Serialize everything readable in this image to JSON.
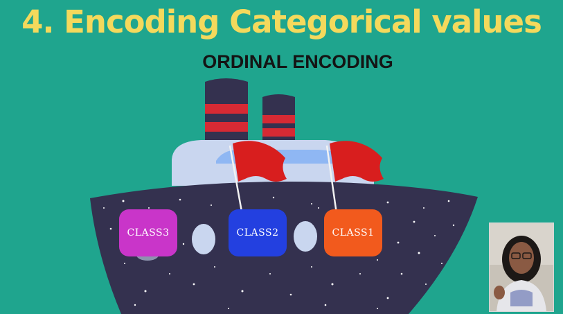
{
  "slide": {
    "title": "4. Encoding Categorical values",
    "subtitle": "ORDINAL ENCODING"
  },
  "classes": [
    {
      "label": "CLASS3",
      "color": "#c935c9",
      "flag": false
    },
    {
      "label": "CLASS2",
      "color": "#2340e0",
      "flag": true
    },
    {
      "label": "CLASS1",
      "color": "#f25a1d",
      "flag": true
    }
  ],
  "colors": {
    "background": "#1fa58e",
    "title": "#f4d95c",
    "hull": "#34314f",
    "funnel_stripe": "#d62a34",
    "flag": "#d81e1e",
    "deck": "#c9d6ef"
  },
  "webcam": {
    "icon": "presenter-video"
  }
}
